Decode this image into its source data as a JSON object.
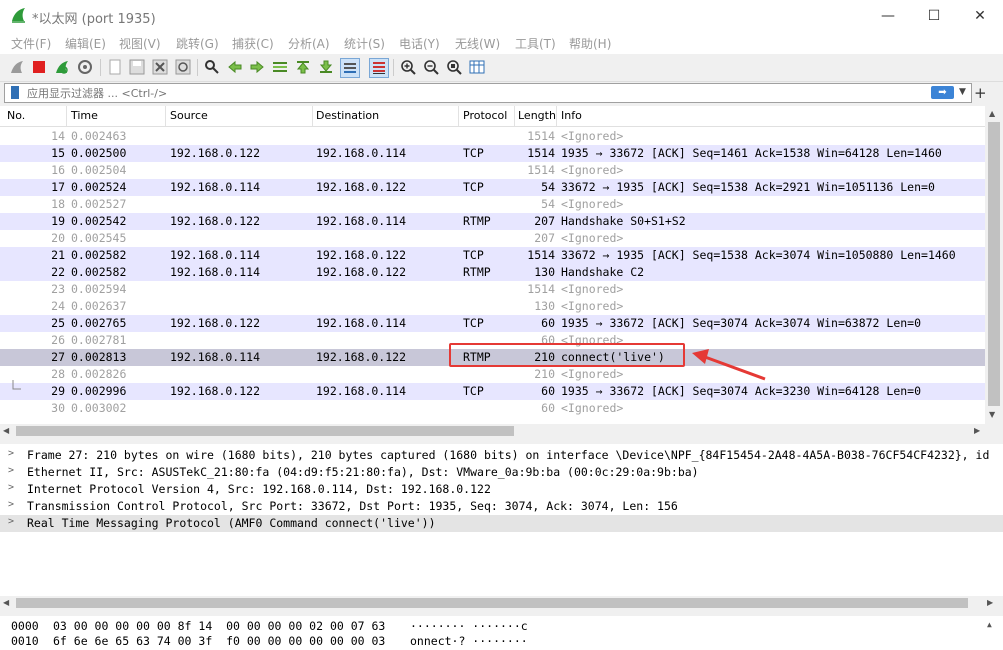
{
  "window": {
    "title": "*以太网 (port 1935)",
    "minimize": "—",
    "maximize": "☐",
    "close": "✕"
  },
  "menu": [
    "文件(F)",
    "编辑(E)",
    "视图(V)",
    "跳转(G)",
    "捕获(C)",
    "分析(A)",
    "统计(S)",
    "电话(Y)",
    "无线(W)",
    "工具(T)",
    "帮助(H)"
  ],
  "filter": {
    "placeholder": "应用显示过滤器 ... <Ctrl-/>",
    "apply_glyph": "➡",
    "dropdown_glyph": "▼",
    "add_glyph": "+"
  },
  "columns": [
    "No.",
    "Time",
    "Source",
    "Destination",
    "Protocol",
    "Length",
    "Info"
  ],
  "packets": [
    {
      "no": "14",
      "time": "0.002463",
      "src": "",
      "dst": "",
      "proto": "",
      "len": "1514",
      "info": "<Ignored>",
      "kind": "ignored"
    },
    {
      "no": "15",
      "time": "0.002500",
      "src": "192.168.0.122",
      "dst": "192.168.0.114",
      "proto": "TCP",
      "len": "1514",
      "info": "1935 → 33672 [ACK] Seq=1461 Ack=1538 Win=64128 Len=1460",
      "kind": "tcp"
    },
    {
      "no": "16",
      "time": "0.002504",
      "src": "",
      "dst": "",
      "proto": "",
      "len": "1514",
      "info": "<Ignored>",
      "kind": "ignored"
    },
    {
      "no": "17",
      "time": "0.002524",
      "src": "192.168.0.114",
      "dst": "192.168.0.122",
      "proto": "TCP",
      "len": "54",
      "info": "33672 → 1935 [ACK] Seq=1538 Ack=2921 Win=1051136 Len=0",
      "kind": "tcp"
    },
    {
      "no": "18",
      "time": "0.002527",
      "src": "",
      "dst": "",
      "proto": "",
      "len": "54",
      "info": "<Ignored>",
      "kind": "ignored"
    },
    {
      "no": "19",
      "time": "0.002542",
      "src": "192.168.0.122",
      "dst": "192.168.0.114",
      "proto": "RTMP",
      "len": "207",
      "info": "Handshake S0+S1+S2",
      "kind": "tcp"
    },
    {
      "no": "20",
      "time": "0.002545",
      "src": "",
      "dst": "",
      "proto": "",
      "len": "207",
      "info": "<Ignored>",
      "kind": "ignored"
    },
    {
      "no": "21",
      "time": "0.002582",
      "src": "192.168.0.114",
      "dst": "192.168.0.122",
      "proto": "TCP",
      "len": "1514",
      "info": "33672 → 1935 [ACK] Seq=1538 Ack=3074 Win=1050880 Len=1460",
      "kind": "tcp"
    },
    {
      "no": "22",
      "time": "0.002582",
      "src": "192.168.0.114",
      "dst": "192.168.0.122",
      "proto": "RTMP",
      "len": "130",
      "info": "Handshake C2",
      "kind": "tcp"
    },
    {
      "no": "23",
      "time": "0.002594",
      "src": "",
      "dst": "",
      "proto": "",
      "len": "1514",
      "info": "<Ignored>",
      "kind": "ignored"
    },
    {
      "no": "24",
      "time": "0.002637",
      "src": "",
      "dst": "",
      "proto": "",
      "len": "130",
      "info": "<Ignored>",
      "kind": "ignored"
    },
    {
      "no": "25",
      "time": "0.002765",
      "src": "192.168.0.122",
      "dst": "192.168.0.114",
      "proto": "TCP",
      "len": "60",
      "info": "1935 → 33672 [ACK] Seq=3074 Ack=3074 Win=63872 Len=0",
      "kind": "tcp"
    },
    {
      "no": "26",
      "time": "0.002781",
      "src": "",
      "dst": "",
      "proto": "",
      "len": "60",
      "info": "<Ignored>",
      "kind": "ignored"
    },
    {
      "no": "27",
      "time": "0.002813",
      "src": "192.168.0.114",
      "dst": "192.168.0.122",
      "proto": "RTMP",
      "len": "210",
      "info": "connect('live')",
      "kind": "selected"
    },
    {
      "no": "28",
      "time": "0.002826",
      "src": "",
      "dst": "",
      "proto": "",
      "len": "210",
      "info": "<Ignored>",
      "kind": "ignored"
    },
    {
      "no": "29",
      "time": "0.002996",
      "src": "192.168.0.122",
      "dst": "192.168.0.114",
      "proto": "TCP",
      "len": "60",
      "info": "1935 → 33672 [ACK] Seq=3074 Ack=3230 Win=64128 Len=0",
      "kind": "tcp"
    },
    {
      "no": "30",
      "time": "0.003002",
      "src": "",
      "dst": "",
      "proto": "",
      "len": "60",
      "info": "<Ignored>",
      "kind": "ignored"
    }
  ],
  "details": [
    "Frame 27: 210 bytes on wire (1680 bits), 210 bytes captured (1680 bits) on interface \\Device\\NPF_{84F15454-2A48-4A5A-B038-76CF54CF4232}, id",
    "Ethernet II, Src: ASUSTekC_21:80:fa (04:d9:f5:21:80:fa), Dst: VMware_0a:9b:ba (00:0c:29:0a:9b:ba)",
    "Internet Protocol Version 4, Src: 192.168.0.114, Dst: 192.168.0.122",
    "Transmission Control Protocol, Src Port: 33672, Dst Port: 1935, Seq: 3074, Ack: 3074, Len: 156",
    "Real Time Messaging Protocol (AMF0 Command connect('live'))"
  ],
  "hex": [
    {
      "offset": "0000",
      "bytes": "03 00 00 00 00 00 8f 14  00 00 00 00 02 00 07 63",
      "ascii": "········ ·······c"
    },
    {
      "offset": "0010",
      "bytes": "6f 6e 6e 65 63 74 00 3f  f0 00 00 00 00 00 00 03",
      "ascii": "onnect·? ········"
    }
  ],
  "colors": {
    "tcp_row": "#e7e6ff",
    "ignored_text": "#a0a0a0",
    "selected_row": "#c8c7d8",
    "highlight_box": "#e53935",
    "arrow": "#e53935"
  }
}
